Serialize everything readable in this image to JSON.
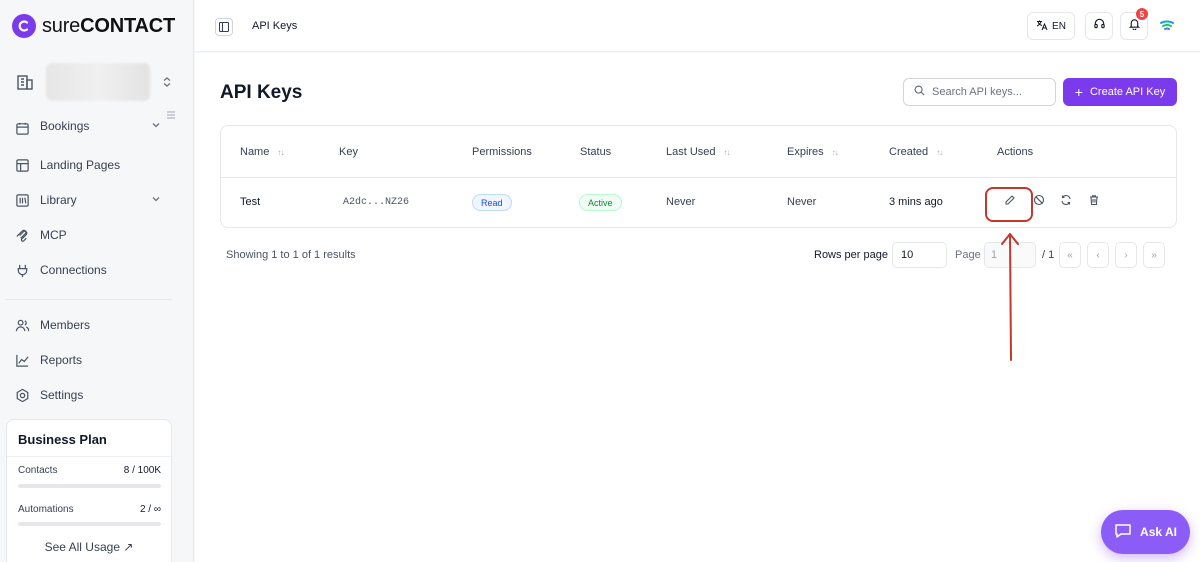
{
  "brand": {
    "name_thin": "sure",
    "name_bold": "CONTACT",
    "accent": "#7c3aed"
  },
  "sidebar": {
    "items": [
      {
        "label": "Bookings",
        "icon": "calendar-icon",
        "chevron": true
      },
      {
        "label": "Landing Pages",
        "icon": "layout-icon",
        "chevron": false
      },
      {
        "label": "Library",
        "icon": "library-icon",
        "chevron": true
      },
      {
        "label": "MCP",
        "icon": "mcp-icon",
        "chevron": false
      },
      {
        "label": "Connections",
        "icon": "plug-icon",
        "chevron": false
      },
      {
        "label": "Members",
        "icon": "users-icon",
        "chevron": false
      },
      {
        "label": "Reports",
        "icon": "chart-icon",
        "chevron": false
      },
      {
        "label": "Settings",
        "icon": "gear-icon",
        "chevron": false
      }
    ],
    "plan": {
      "title": "Business Plan",
      "contacts_label": "Contacts",
      "contacts_value": "8 / 100K",
      "contacts_fraction": 0.0001,
      "automations_label": "Automations",
      "automations_value": "2 / ∞",
      "automations_fraction": 0,
      "see_all": "See All Usage ↗"
    }
  },
  "topbar": {
    "title": "API Keys",
    "lang": "EN",
    "notification_count": "5"
  },
  "main": {
    "title": "API Keys",
    "search_placeholder": "Search API keys...",
    "create_label": "Create API Key",
    "columns": [
      "Name",
      "Key",
      "Permissions",
      "Status",
      "Last Used",
      "Expires",
      "Created",
      "Actions"
    ],
    "rows": [
      {
        "name": "Test",
        "key": "A2dc...NZ26",
        "permission": "Read",
        "status": "Active",
        "last_used": "Never",
        "expires": "Never",
        "created": "3 mins ago"
      }
    ],
    "footer": {
      "showing": "Showing 1 to 1 of 1 results",
      "rows_per_page_label": "Rows per page",
      "rows_per_page": "10",
      "page_label": "Page",
      "page": "1",
      "page_total": "/ 1",
      "first": "«",
      "prev": "‹",
      "next": "›",
      "last": "»"
    }
  },
  "ask_ai": "Ask AI",
  "annotation_color": "#c0392b"
}
